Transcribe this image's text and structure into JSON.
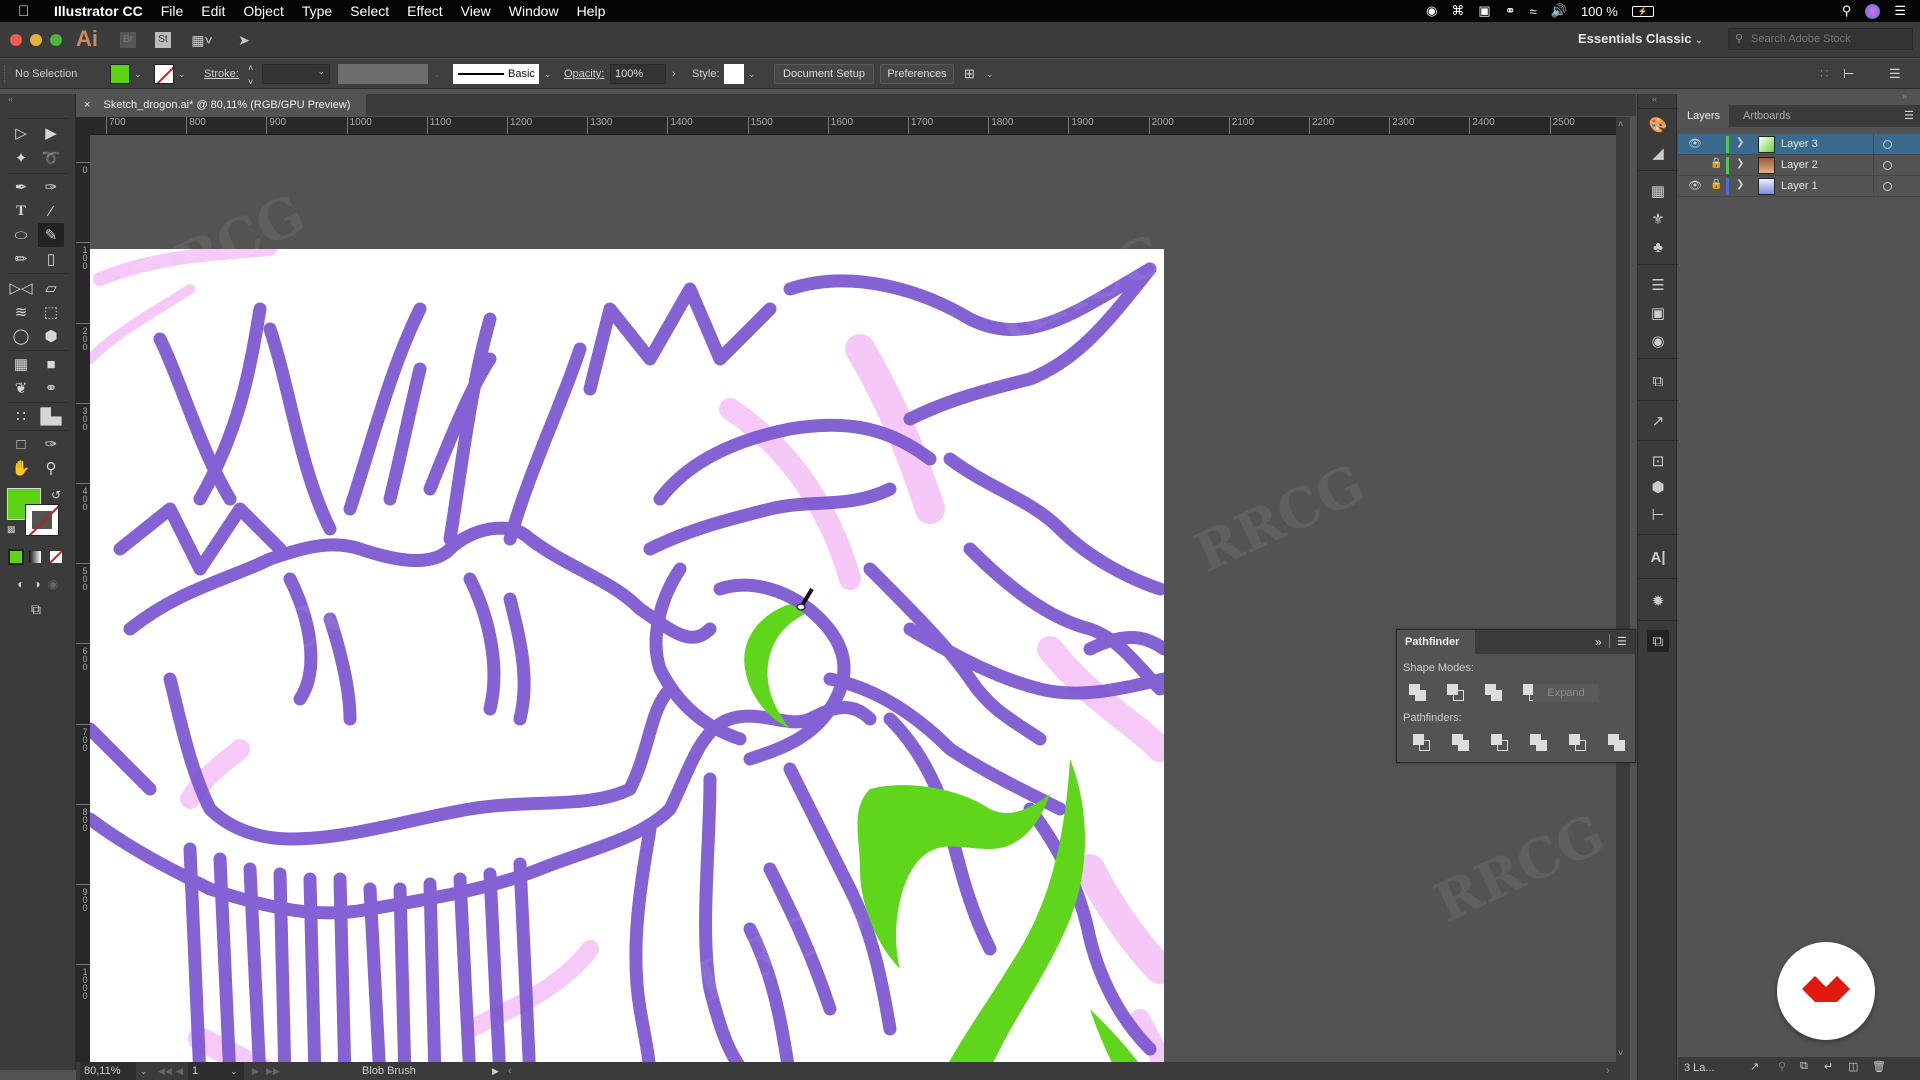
{
  "menubar": {
    "app_name": "Illustrator CC",
    "menus": [
      "File",
      "Edit",
      "Object",
      "Type",
      "Select",
      "Effect",
      "View",
      "Window",
      "Help"
    ],
    "status": {
      "battery": "100 %"
    }
  },
  "appbar": {
    "logo": "Ai",
    "bridge": "Br",
    "stock": "St",
    "workspace": "Essentials Classic",
    "search_placeholder": "Search Adobe Stock"
  },
  "control_bar": {
    "selection": "No Selection",
    "fill_color": "#5ed315",
    "stroke_label": "Stroke:",
    "stroke_value": "",
    "brush_profile": "Basic",
    "opacity_label": "Opacity:",
    "opacity_value": "100%",
    "style_label": "Style:",
    "document_setup": "Document Setup",
    "preferences": "Preferences"
  },
  "document": {
    "tab_title": "Sketch_drogon.ai* @ 80,11% (RGB/GPU Preview)",
    "close_glyph": "×"
  },
  "rulers": {
    "horizontal": [
      "700",
      "800",
      "900",
      "1000",
      "1100",
      "1200",
      "1300",
      "1400",
      "1500",
      "1600",
      "1700",
      "1800",
      "1900",
      "2000",
      "2100",
      "2200",
      "2300",
      "2400",
      "2500"
    ],
    "vertical": [
      "100",
      "0",
      "100",
      "200",
      "300",
      "400",
      "500",
      "600",
      "700",
      "800",
      "900",
      "1000"
    ]
  },
  "tools": {
    "fill_color": "#5ed315",
    "stroke_color": "none",
    "active_tool": "Blob Brush"
  },
  "statusbar": {
    "zoom": "80,11%",
    "artboard_number": "1",
    "current_tool": "Blob Brush"
  },
  "layers_panel": {
    "tabs": [
      "Layers",
      "Artboards"
    ],
    "active_tab": "Layers",
    "layers": [
      {
        "name": "Layer 3",
        "visible": true,
        "locked": false,
        "color": "#4fc94f",
        "selected": true
      },
      {
        "name": "Layer 2",
        "visible": false,
        "locked": true,
        "color": "#4fc94f",
        "selected": false
      },
      {
        "name": "Layer 1",
        "visible": true,
        "locked": true,
        "color": "#4f6ad6",
        "selected": false
      }
    ],
    "footer_count": "3 La..."
  },
  "pathfinder": {
    "title": "Pathfinder",
    "shape_modes_label": "Shape Modes:",
    "expand_label": "Expand",
    "pathfinders_label": "Pathfinders:",
    "shape_modes": [
      "Unite",
      "Minus Front",
      "Intersect",
      "Exclude"
    ],
    "pathfinders": [
      "Divide",
      "Trim",
      "Merge",
      "Crop",
      "Outline",
      "Minus Back"
    ]
  },
  "artwork": {
    "purple": "#7a55d0",
    "green": "#5fd61b",
    "pink": "#ee9cf2"
  },
  "watermark": "RRCG"
}
